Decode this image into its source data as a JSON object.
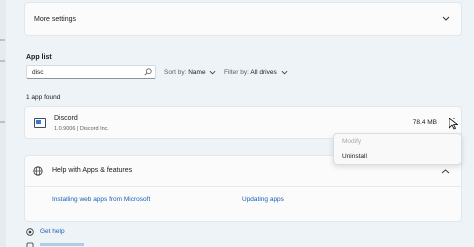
{
  "more_settings": {
    "label": "More settings",
    "icon": "chevron-down-icon"
  },
  "app_list": {
    "title": "App list",
    "search": {
      "value": "disc",
      "icon": "search-icon"
    },
    "sort": {
      "label": "Sort by:",
      "value": "Name"
    },
    "filter": {
      "label": "Filter by:",
      "value": "All drives"
    },
    "found_text": "1 app found"
  },
  "apps": [
    {
      "name": "Discord",
      "version": "1.0.9006",
      "publisher": "Discord Inc.",
      "size": "78.4 MB",
      "icon": "discord-app-icon"
    }
  ],
  "context_menu": {
    "items": [
      {
        "label": "Modify",
        "enabled": false
      },
      {
        "label": "Uninstall",
        "enabled": true
      }
    ]
  },
  "help": {
    "title": "Help with Apps & features",
    "links": [
      "Installing web apps from Microsoft",
      "Updating apps"
    ]
  },
  "bottom": {
    "get_help": "Get help"
  },
  "colors": {
    "link": "#1a5fb4",
    "background": "#eef3f8",
    "card": "#fbfbfb"
  }
}
